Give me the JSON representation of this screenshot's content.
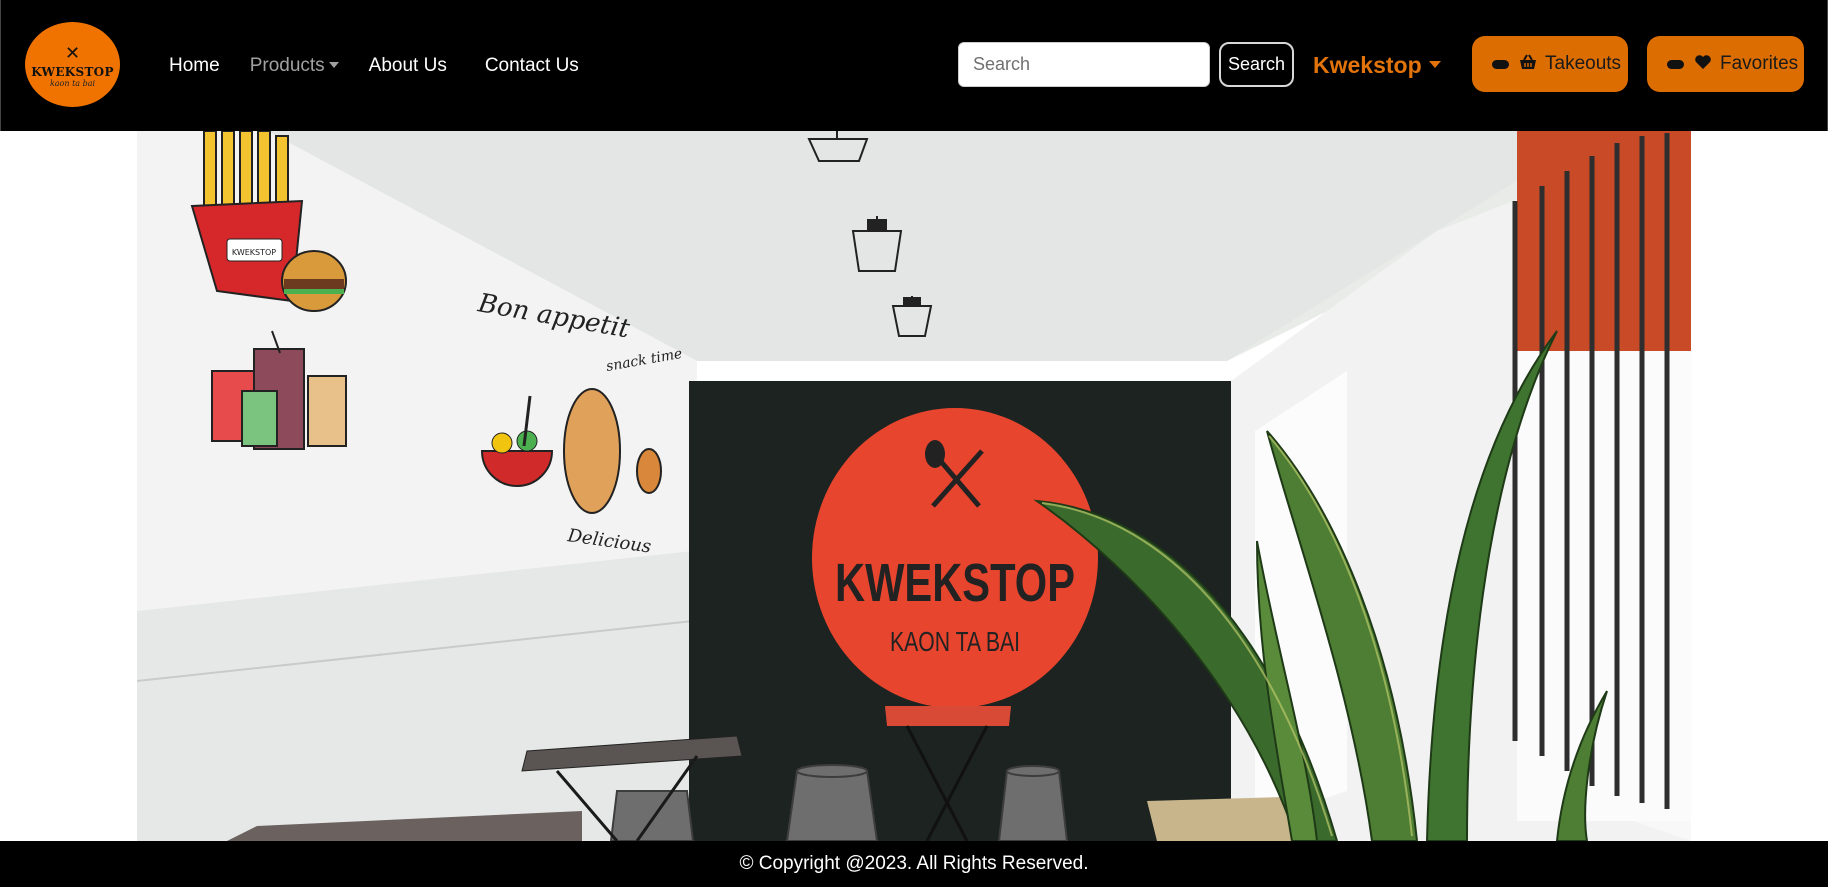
{
  "brand": {
    "logo_text": "KWEKSTOP",
    "logo_subtext": "kaon ta bai",
    "logo_icon": "fork-knife-icon",
    "logo_color": "#f07300"
  },
  "nav": {
    "home": "Home",
    "products": "Products",
    "about": "About Us",
    "contact": "Contact Us"
  },
  "search": {
    "placeholder": "Search",
    "button_label": "Search"
  },
  "user_menu": {
    "label": "Kwekstop"
  },
  "actions": {
    "takeouts_label": "Takeouts",
    "takeouts_icon": "basket-icon",
    "favorites_label": "Favorites",
    "favorites_icon": "heart-icon",
    "accent_color": "#dc6d00"
  },
  "hero": {
    "sign_title": "KWEKSTOP",
    "sign_subtitle": "KAON TA BAI",
    "wall_text_1": "Bon appetit",
    "wall_text_2": "snack time",
    "wall_text_3": "Delicious",
    "fries_box_text": "KWEKSTOP"
  },
  "footer": {
    "copyright": "© Copyright @2023. All Rights Reserved."
  }
}
